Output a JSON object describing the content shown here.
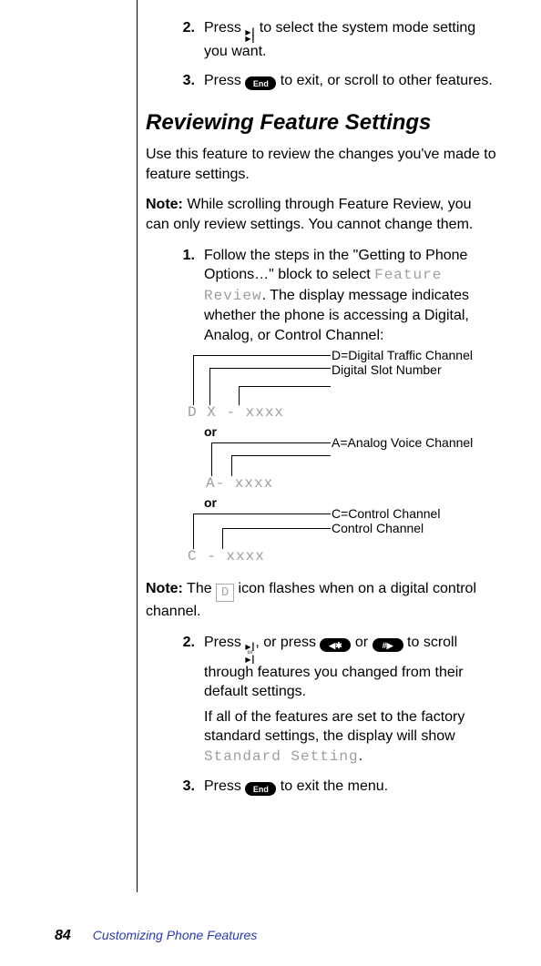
{
  "intro_steps": {
    "s2_num": "2.",
    "s2_a": "Press ",
    "s2_b": " to select the system mode setting you want.",
    "s3_num": "3.",
    "s3_a": "Press ",
    "s3_b": " to exit, or scroll to other features."
  },
  "heading": "Reviewing Feature Settings",
  "intro_para": "Use this feature to review the changes you've made to feature settings.",
  "note1_label": "Note:",
  "note1_text": " While scrolling through Feature Review, you can only review settings. You cannot change them.",
  "steps": {
    "s1_num": "1.",
    "s1_a": "Follow the steps in the \"Getting to Phone Options…\" block to select ",
    "s1_code": "Feature Review",
    "s1_b": ". The display message indicates whether the phone is accessing a Digital, Analog, or Control Channel:",
    "s2_num": "2.",
    "s2_a": "Press    ",
    "s2_b": ", or press ",
    "s2_c": " or ",
    "s2_d": " to scroll through features you changed from their default settings.",
    "s2_para2_a": "If all of the features are set to the factory standard settings, the display will show ",
    "s2_para2_code": "Standard Setting",
    "s2_para2_b": ".",
    "s3_num": "3.",
    "s3_a": "Press ",
    "s3_b": " to exit the menu."
  },
  "diagram": {
    "d1_r1": "D=Digital Traffic Channel",
    "d1_r2": "Digital Slot Number",
    "d1_lcd": "D X - xxxx",
    "or1": "or",
    "a1_r1": "A=Analog Voice Channel",
    "a1_lcd": "A- xxxx",
    "or2": "or",
    "c1_r1": "C=Control Channel",
    "c1_r2": "Control Channel",
    "c1_lcd": "C - xxxx"
  },
  "note2_label": "Note:",
  "note2_a": " The ",
  "note2_b": " icon flashes when on a digital control channel.",
  "d_box": "D",
  "keys": {
    "end": "End",
    "star": "✱",
    "hash": "#",
    "arrow_up": "▶┃",
    "arrow_down": "▶┃",
    "or_small": "or"
  },
  "footer": {
    "page_number": "84",
    "title": "Customizing Phone Features"
  }
}
